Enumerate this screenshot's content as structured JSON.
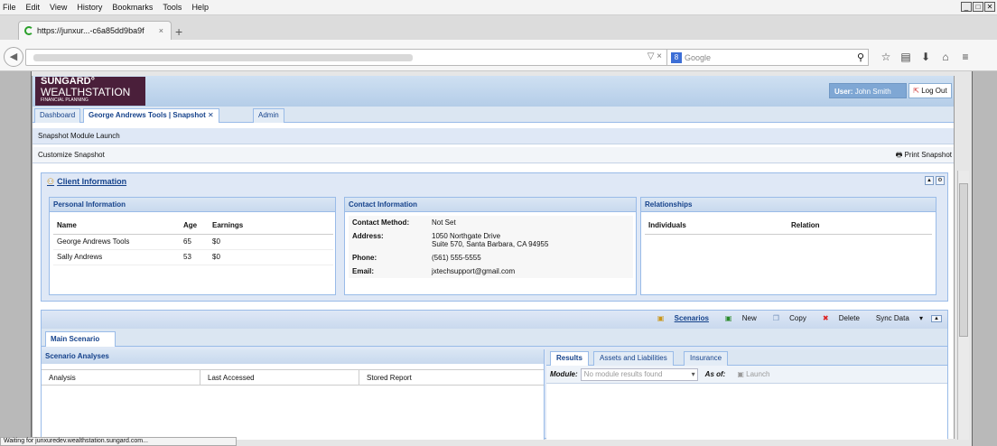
{
  "browser": {
    "menu": [
      "File",
      "Edit",
      "View",
      "History",
      "Bookmarks",
      "Tools",
      "Help"
    ],
    "tab_title": "https://junxur...-c6a85dd9ba9f",
    "tab_close": "×",
    "new_tab": "+",
    "search_engine": "8",
    "search_placeholder": "Google",
    "url_controls": "▽ ×",
    "status_text": "Waiting for junxuredev.wealthstation.sungard.com..."
  },
  "app": {
    "logo_line1": "SUNGARD°",
    "logo_line2": "WEALTHSTATION",
    "logo_line3": "FINANCIAL PLANNING",
    "user_label": "User:",
    "user_name": "John Smith",
    "logout_label": "Log Out",
    "tabs": [
      "Dashboard",
      "George Andrews Tools | Snapshot",
      "Admin"
    ],
    "toolbar1": "Snapshot  Module Launch",
    "toolbar2": "Customize Snapshot",
    "print_label": "Print Snapshot"
  },
  "client_info": {
    "title": "Client Information",
    "personal": {
      "title": "Personal Information",
      "headers": [
        "Name",
        "Age",
        "Earnings"
      ],
      "rows": [
        [
          "George Andrews Tools",
          "65",
          "$0"
        ],
        [
          "Sally Andrews",
          "53",
          "$0"
        ]
      ]
    },
    "contact": {
      "title": "Contact Information",
      "method_label": "Contact Method:",
      "method_value": "Not Set",
      "address_label": "Address:",
      "address_line1": "1050 Northgate Drive",
      "address_line2": "Suite 570, Santa Barbara, CA 94955",
      "phone_label": "Phone:",
      "phone_value": "(561) 555-5555",
      "email_label": "Email:",
      "email_value": "jxtechsupport@gmail.com"
    },
    "relationships": {
      "title": "Relationships",
      "headers": [
        "Individuals",
        "Relation"
      ]
    }
  },
  "scenarios": {
    "buttons": [
      "Scenarios",
      "New",
      "Copy",
      "Delete",
      "Sync Data"
    ],
    "main_tab": "Main Scenario",
    "analyses_title": "Scenario Analyses",
    "analyses_cols": [
      "Analysis",
      "Last Accessed",
      "Stored Report"
    ],
    "result_tabs": [
      "Results",
      "Assets and Liabilities",
      "Insurance"
    ],
    "module_label": "Module:",
    "module_placeholder": "No module results found",
    "asof_label": "As of:",
    "launch_label": "Launch"
  },
  "colors": {
    "accent": "#15428b",
    "header_bg": "#dfe8f6",
    "logo_bg": "#4a1f3a"
  }
}
